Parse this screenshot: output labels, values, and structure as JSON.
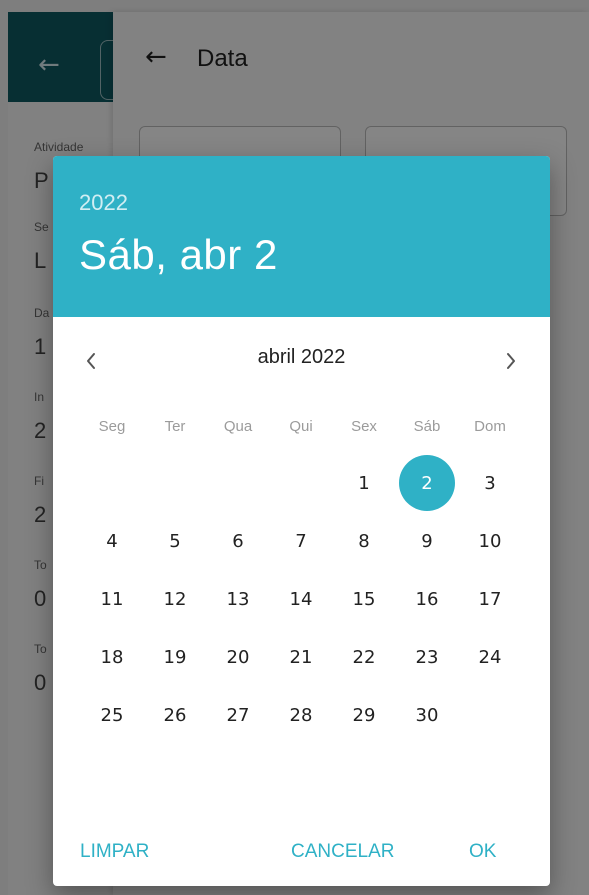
{
  "background": {
    "labels": [
      "Atividade",
      "Se",
      "Da",
      "In",
      "Fi",
      "To",
      "To"
    ],
    "values": [
      "P",
      "L",
      "1",
      "2",
      "2",
      "0",
      "0"
    ]
  },
  "data_dialog": {
    "title": "Data"
  },
  "date_picker": {
    "year": "2022",
    "selected_label": "Sáb, abr 2",
    "month_label": "abril 2022",
    "weekdays": [
      "Seg",
      "Ter",
      "Qua",
      "Qui",
      "Sex",
      "Sáb",
      "Dom"
    ],
    "days": [
      "1",
      "2",
      "3",
      "4",
      "5",
      "6",
      "7",
      "8",
      "9",
      "10",
      "11",
      "12",
      "13",
      "14",
      "15",
      "16",
      "17",
      "18",
      "19",
      "20",
      "21",
      "22",
      "23",
      "24",
      "25",
      "26",
      "27",
      "28",
      "29",
      "30"
    ],
    "selected_day": "2",
    "actions": {
      "clear": "LIMPAR",
      "cancel": "CANCELAR",
      "ok": "OK"
    }
  },
  "colors": {
    "accent": "#2fb1c6",
    "dark_header": "#0f5a63"
  },
  "icons": {
    "back": "arrow-left-icon",
    "prev": "chevron-left-icon",
    "next": "chevron-right-icon"
  }
}
